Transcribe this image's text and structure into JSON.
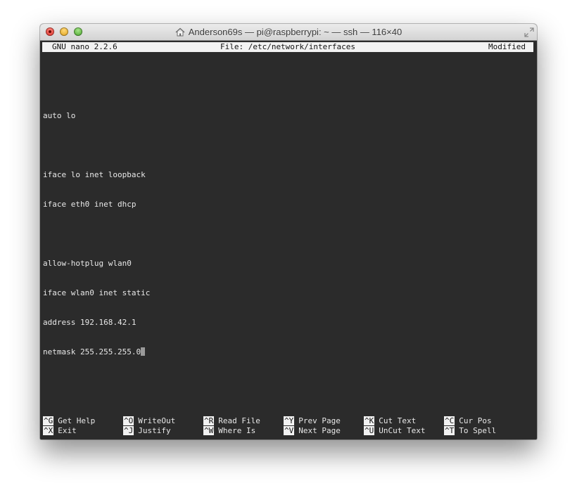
{
  "window": {
    "title": "Anderson69s — pi@raspberrypi: ~ — ssh — 116×40"
  },
  "nano": {
    "version": "GNU nano 2.2.6",
    "file": "File: /etc/network/interfaces",
    "status": "Modified",
    "lines": [
      "",
      "auto lo",
      "",
      "iface lo inet loopback",
      "iface eth0 inet dhcp",
      "",
      "allow-hotplug wlan0",
      "iface wlan0 inet static",
      "address 192.168.42.1",
      "netmask 255.255.255.0"
    ],
    "shortcuts_row1": [
      {
        "key": "^G",
        "label": "Get Help"
      },
      {
        "key": "^O",
        "label": "WriteOut"
      },
      {
        "key": "^R",
        "label": "Read File"
      },
      {
        "key": "^Y",
        "label": "Prev Page"
      },
      {
        "key": "^K",
        "label": "Cut Text"
      },
      {
        "key": "^C",
        "label": "Cur Pos"
      }
    ],
    "shortcuts_row2": [
      {
        "key": "^X",
        "label": "Exit"
      },
      {
        "key": "^J",
        "label": "Justify"
      },
      {
        "key": "^W",
        "label": "Where Is"
      },
      {
        "key": "^V",
        "label": "Next Page"
      },
      {
        "key": "^U",
        "label": "UnCut Text"
      },
      {
        "key": "^T",
        "label": "To Spell"
      }
    ]
  }
}
